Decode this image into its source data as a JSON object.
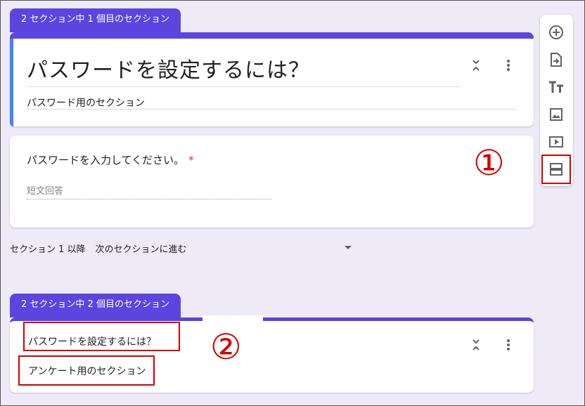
{
  "section1": {
    "tab_label": "2 セクション中 1 個目のセクション",
    "title": "パスワードを設定するには？",
    "description": "パスワード用のセクション"
  },
  "question": {
    "label": "パスワードを入力してください。",
    "required_mark": "*",
    "answer_placeholder": "短文回答"
  },
  "after_section": {
    "label": "セクション 1 以降",
    "value": "次のセクションに進む"
  },
  "section2": {
    "tab_label": "2 セクション中 2 個目のセクション",
    "title": "パスワードを設定するには？",
    "description": "アンケート用のセクション"
  },
  "annotations": {
    "marker1": "①",
    "marker2": "②"
  },
  "toolbar": {
    "items": [
      "add-question-icon",
      "import-questions-icon",
      "add-title-icon",
      "add-image-icon",
      "add-video-icon",
      "add-section-icon"
    ]
  },
  "colors": {
    "accent": "#5b45e0",
    "annotation": "#d40000",
    "required": "#d93025"
  }
}
